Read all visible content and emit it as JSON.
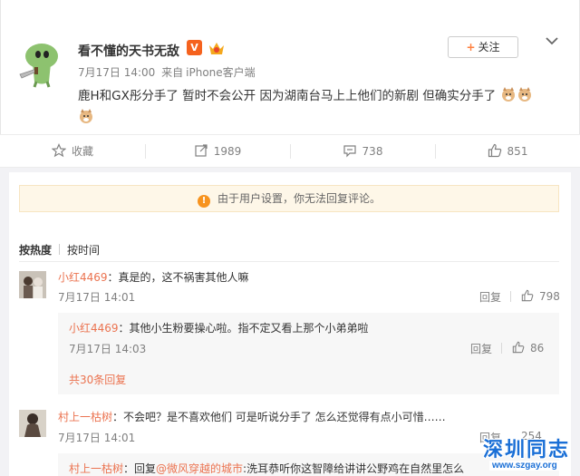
{
  "post": {
    "username": "看不懂的天书无敌",
    "verified_badge": "V",
    "time": "7月17日 14:00",
    "source_prefix": "来自",
    "source": "iPhone客户端",
    "follow_label": "关注",
    "follow_plus": "+",
    "content": "鹿H和GX彤分手了 暂时不会公开 因为湖南台马上上他们的新剧 但确实分手了"
  },
  "actions": {
    "favorite_label": "收藏",
    "repost_count": "1989",
    "comment_count": "738",
    "like_count": "851"
  },
  "notice": {
    "icon": "!",
    "text": "由于用户设置，你无法回复评论。"
  },
  "tabs": {
    "by_hot": "按热度",
    "by_time": "按时间"
  },
  "comments": [
    {
      "name": "小红4469",
      "text": "：真是的，这不祸害其他人嘛",
      "time": "7月17日 14:01",
      "reply_label": "回复",
      "likes": "798"
    },
    {
      "name": "小红4469",
      "text": "：其他小生粉要操心啦。指不定又看上那个小弟弟啦",
      "time": "7月17日 14:03",
      "reply_label": "回复",
      "likes": "86"
    },
    {
      "name": "村上一枯树",
      "text": "：不会吧？是不喜欢他们 可是听说分手了 怎么还觉得有点小可惜……",
      "time": "7月17日 14:01",
      "reply_label": "回复",
      "likes": "254"
    },
    {
      "name": "村上一枯树",
      "reply_prefix": "：回复",
      "mention": "@微风穿越的城市",
      "text": ":洗耳恭听你这智障给讲讲公野鸡在自然里怎么"
    }
  ],
  "more_replies": "共30条回复",
  "watermark": {
    "title": "深圳同志",
    "url": "www.szgay.org"
  },
  "colors": {
    "accent_orange": "#eb7350",
    "notice_bg": "#fef7e8",
    "watermark_blue": "#1a6fd6"
  }
}
